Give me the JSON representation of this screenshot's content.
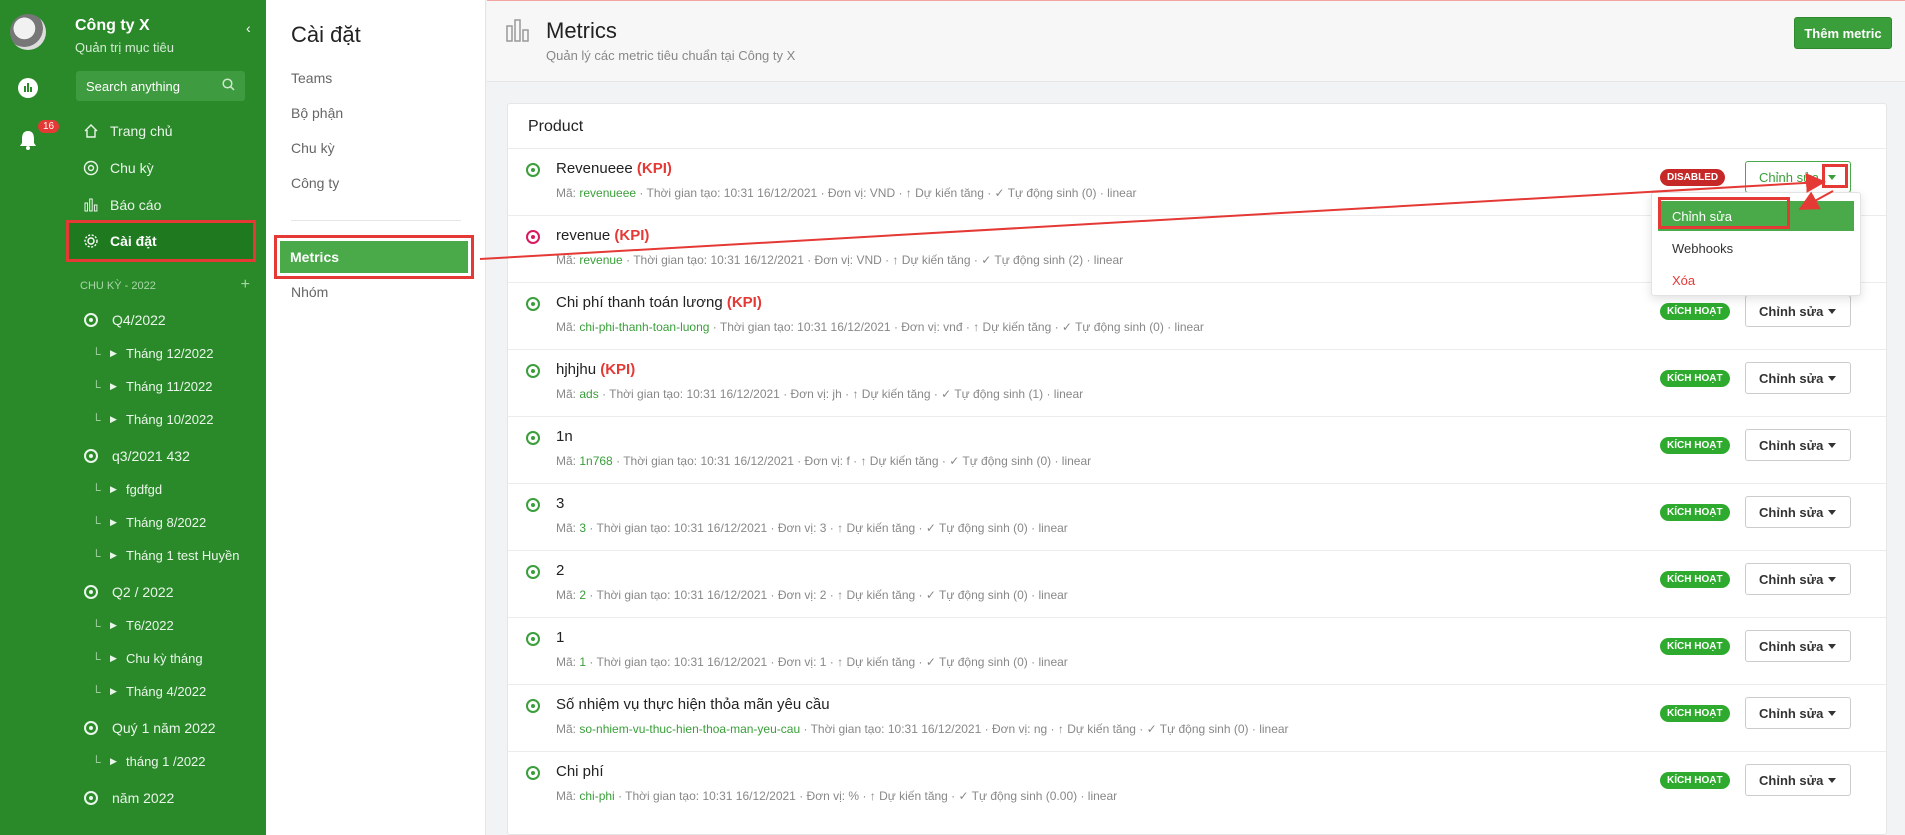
{
  "app": {
    "company": "Công ty X",
    "company_sub": "Quản trị mục tiêu",
    "search_placeholder": "Search anything",
    "notification_count": "16"
  },
  "nav": {
    "home": "Trang chủ",
    "cycle": "Chu kỳ",
    "report": "Báo cáo",
    "settings": "Cài đặt"
  },
  "cycles": {
    "header": "CHU KỲ - 2022",
    "add": "+",
    "items": [
      {
        "label": "Q4/2022"
      },
      {
        "label": "Tháng 12/2022"
      },
      {
        "label": "Tháng 11/2022"
      },
      {
        "label": "Tháng 10/2022"
      },
      {
        "label": "q3/2021 432"
      },
      {
        "label": "fgdfgd"
      },
      {
        "label": "Tháng 8/2022"
      },
      {
        "label": "Tháng 1 test Huyền"
      },
      {
        "label": "Q2 / 2022"
      },
      {
        "label": "T6/2022"
      },
      {
        "label": "Chu kỳ tháng"
      },
      {
        "label": "Tháng 4/2022"
      },
      {
        "label": "Quý 1 năm 2022"
      },
      {
        "label": "tháng 1 /2022"
      },
      {
        "label": "năm 2022"
      }
    ]
  },
  "settings": {
    "title": "Cài đặt",
    "items": [
      "Teams",
      "Bộ phận",
      "Chu kỳ",
      "Công ty"
    ],
    "active": "Metrics",
    "after": "Nhóm"
  },
  "header": {
    "title": "Metrics",
    "subtitle": "Quản lý các metric tiêu chuẩn tại Công ty X",
    "add_button": "Thêm metric"
  },
  "card": {
    "title": "Product",
    "kpi_tag": "(KPI)",
    "edit_label": "Chỉnh sửa",
    "labels": {
      "code": "Mã:",
      "created": "· Thời gian tạo:",
      "unit": "· Đơn vị:",
      "trend": "· ↑ Dự kiến tăng · ✓ Tự động sinh",
      "method": "· linear"
    },
    "rows": [
      {
        "name": "Revenueee",
        "kpi": true,
        "code": "revenueee",
        "created": "10:31 16/12/2021",
        "unit": "VND",
        "auto": "(0)",
        "status": "DISABLED",
        "icon": "green"
      },
      {
        "name": "revenue",
        "kpi": true,
        "code": "revenue",
        "created": "10:31 16/12/2021",
        "unit": "VND",
        "auto": "(2)",
        "status": "",
        "icon": "pink"
      },
      {
        "name": "Chi phí thanh toán lương",
        "kpi": true,
        "code": "chi-phi-thanh-toan-luong",
        "created": "10:31 16/12/2021",
        "unit": "vnđ",
        "auto": "(0)",
        "status": "KÍCH HOẠT",
        "icon": "green"
      },
      {
        "name": "hjhjhu",
        "kpi": true,
        "code": "ads",
        "created": "10:31 16/12/2021",
        "unit": "jh",
        "auto": "(1)",
        "status": "KÍCH HOẠT",
        "icon": "green"
      },
      {
        "name": "1n",
        "kpi": false,
        "code": "1n768",
        "created": "10:31 16/12/2021",
        "unit": "f",
        "auto": "(0)",
        "status": "KÍCH HOẠT",
        "icon": "green"
      },
      {
        "name": "3",
        "kpi": false,
        "code": "3",
        "created": "10:31 16/12/2021",
        "unit": "3",
        "auto": "(0)",
        "status": "KÍCH HOẠT",
        "icon": "green"
      },
      {
        "name": "2",
        "kpi": false,
        "code": "2",
        "created": "10:31 16/12/2021",
        "unit": "2",
        "auto": "(0)",
        "status": "KÍCH HOẠT",
        "icon": "green"
      },
      {
        "name": "1",
        "kpi": false,
        "code": "1",
        "created": "10:31 16/12/2021",
        "unit": "1",
        "auto": "(0)",
        "status": "KÍCH HOẠT",
        "icon": "green"
      },
      {
        "name": "Số nhiệm vụ thực hiện thỏa mãn yêu cầu",
        "kpi": false,
        "code": "so-nhiem-vu-thuc-hien-thoa-man-yeu-cau",
        "created": "10:31 16/12/2021",
        "unit": "ng",
        "auto": "(0)",
        "status": "KÍCH HOẠT",
        "icon": "green"
      },
      {
        "name": "Chi phí",
        "kpi": false,
        "code": "chi-phi",
        "created": "10:31 16/12/2021",
        "unit": "%",
        "auto": "(0.00)",
        "status": "KÍCH HOẠT",
        "icon": "green"
      }
    ]
  },
  "dropdown": {
    "items": [
      "Chỉnh sửa",
      "Webhooks",
      "Xóa"
    ]
  },
  "colors": {
    "sidebar": "#2a8a2a",
    "accent": "#3a9e3a",
    "highlight": "#e53935",
    "disabled": "#c62828"
  }
}
